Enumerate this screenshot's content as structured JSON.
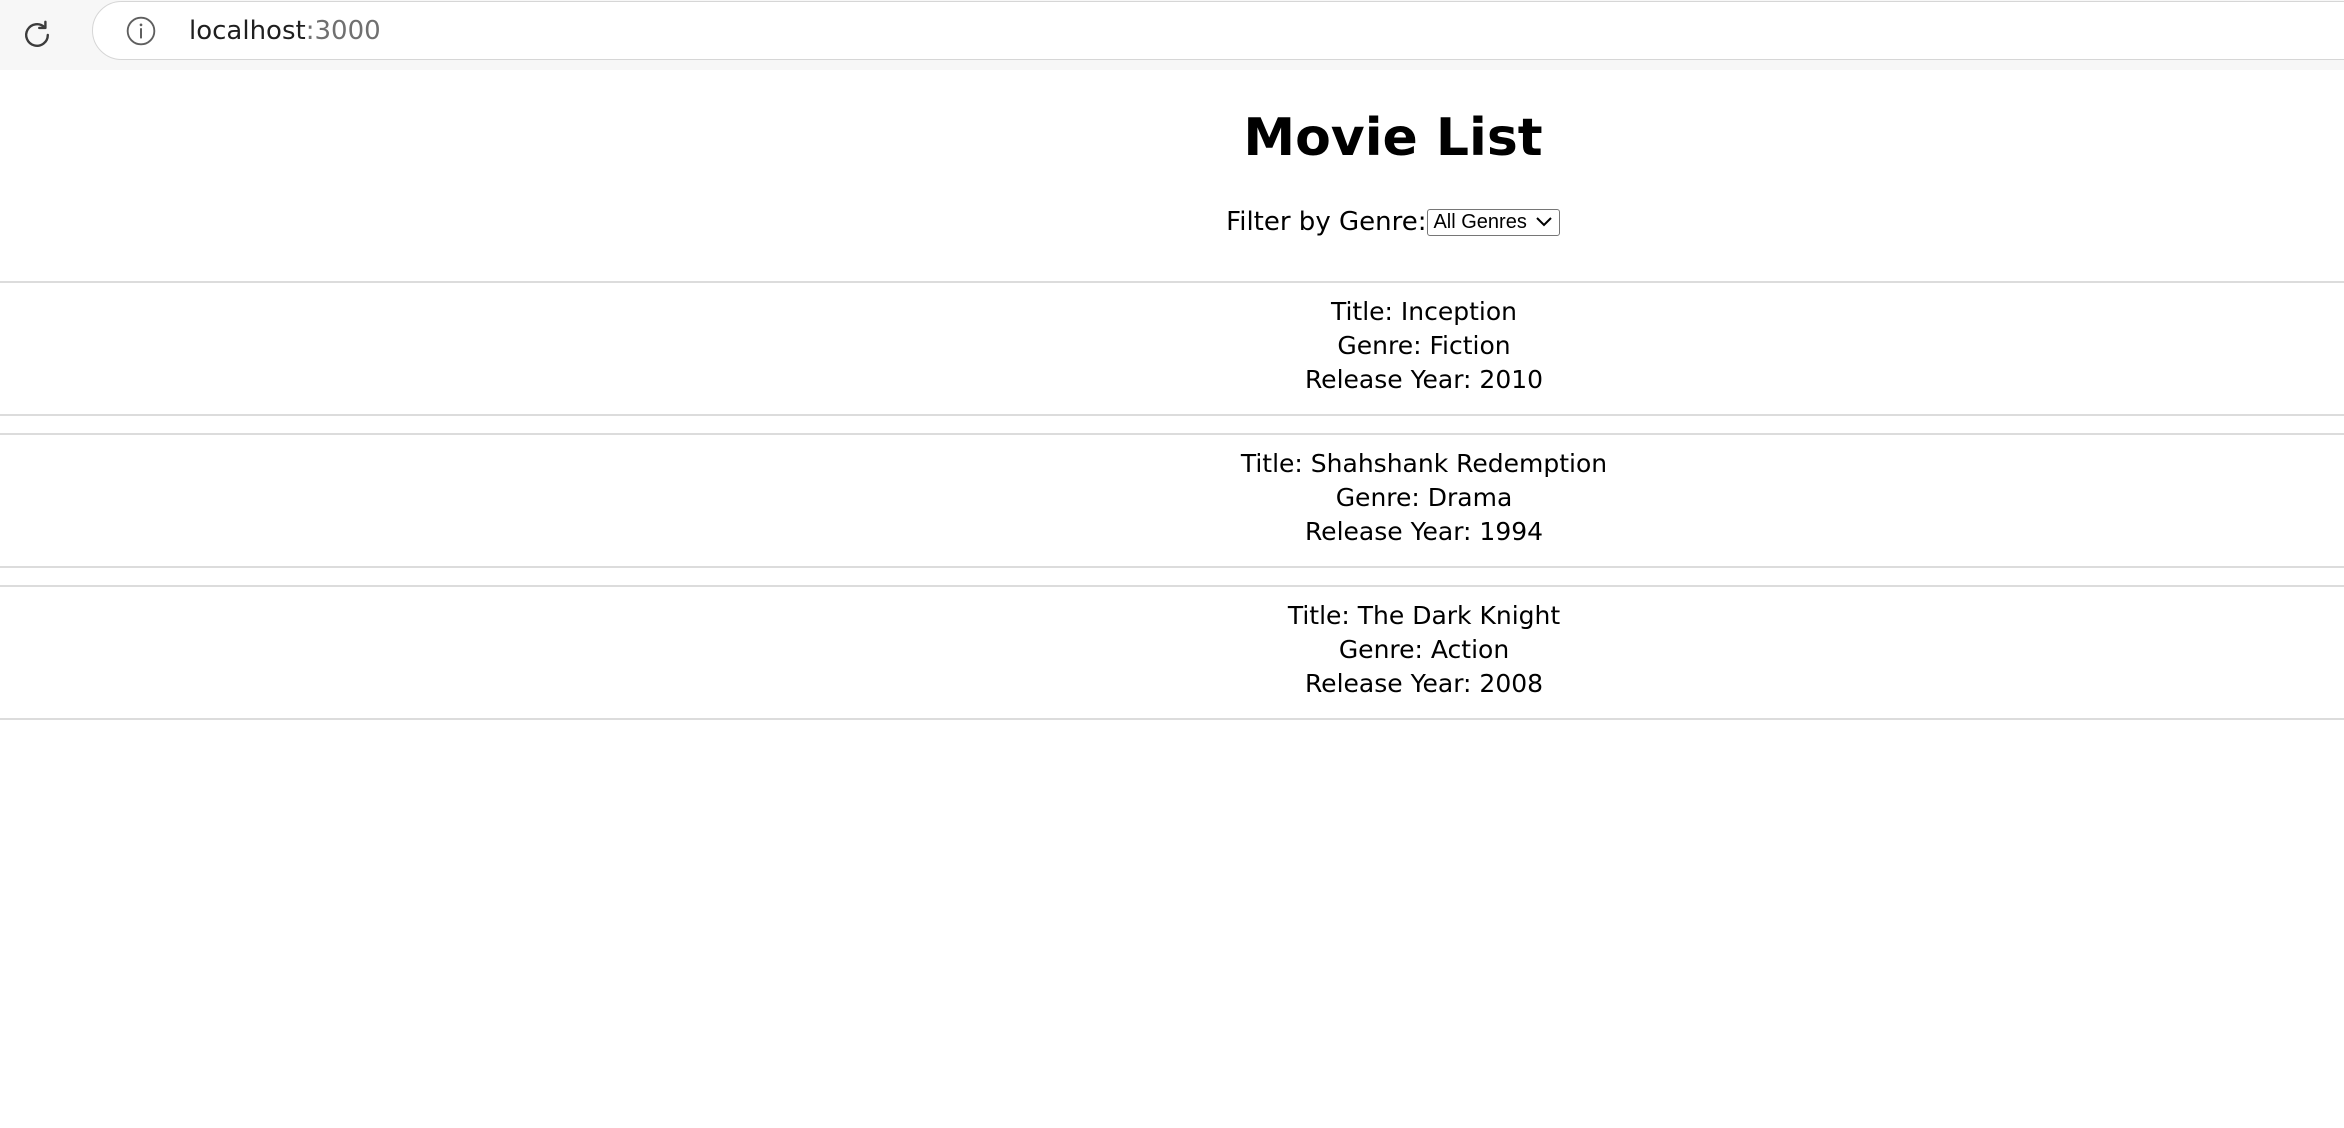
{
  "browser": {
    "url_host": "localhost",
    "url_port": ":3000"
  },
  "page": {
    "title": "Movie List",
    "filter_label": "Filter by Genre:",
    "filter_selected": "All Genres"
  },
  "movies": [
    {
      "title": "Title: Inception",
      "genre": "Genre: Fiction",
      "year": "Release Year: 2010"
    },
    {
      "title": "Title: Shahshank Redemption",
      "genre": "Genre: Drama",
      "year": "Release Year: 1994"
    },
    {
      "title": "Title: The Dark Knight",
      "genre": "Genre: Action",
      "year": "Release Year: 2008"
    }
  ],
  "icons": {
    "reload": "reload-icon",
    "info": "info-icon",
    "dropdown": "chevron-down-icon"
  }
}
